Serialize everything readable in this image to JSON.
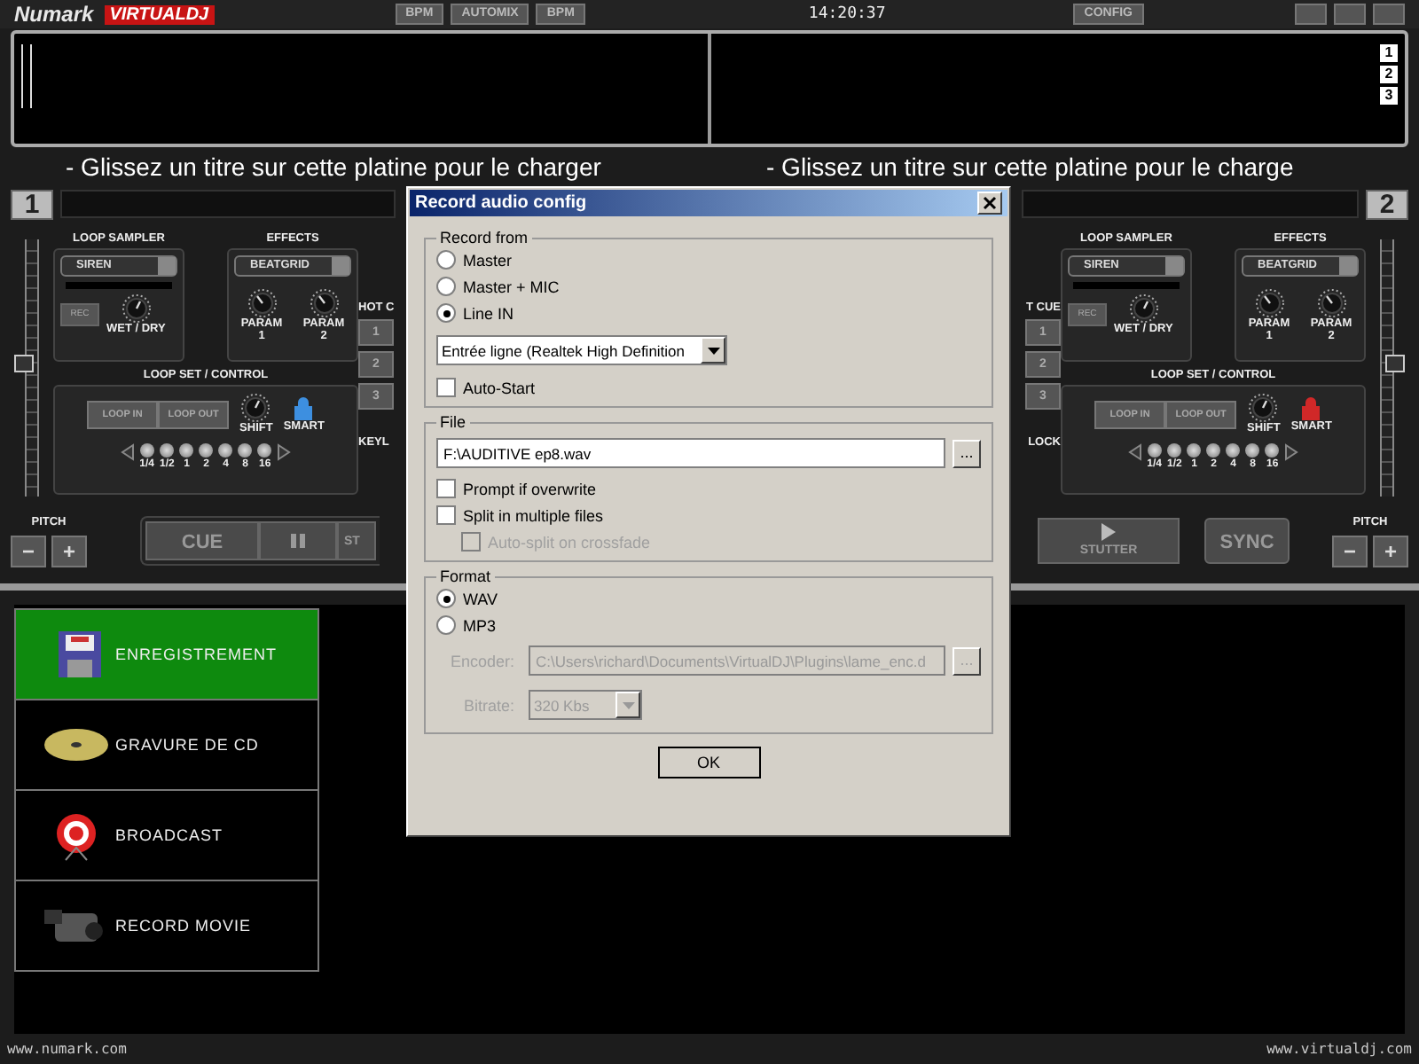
{
  "top_bar": {
    "brand": "Numark",
    "product": "VIRTUALDJ",
    "buttons": [
      "BPM",
      "AUTOMIX",
      "BPM"
    ],
    "clock": "14:20:37",
    "config": "CONFIG"
  },
  "waveform": {
    "deck_numbers": [
      "1",
      "2",
      "3"
    ]
  },
  "drop_hints": [
    "- Glissez un titre sur cette platine pour le charger",
    "- Glissez un titre sur cette platine pour le charge"
  ],
  "decks": [
    {
      "number": "1",
      "pitch_slider": {
        "level": 0.52
      },
      "loop_sampler": {
        "title": "LOOP SAMPLER",
        "sample": "SIREN",
        "rec": "REC",
        "knob": "WET / DRY"
      },
      "effects": {
        "title": "EFFECTS",
        "effect": "BEATGRID",
        "params": [
          "PARAM 1",
          "PARAM 2"
        ]
      },
      "loop_control": {
        "title": "LOOP SET / CONTROL",
        "loop_in": "LOOP IN",
        "loop_out": "LOOP OUT",
        "shift": "SHIFT",
        "smart": {
          "label": "SMART",
          "color": "#3d8fe0"
        },
        "lengths": [
          "1/4",
          "1/2",
          "1",
          "2",
          "4",
          "8",
          "16"
        ]
      },
      "hot_cue": {
        "title": "HOT C",
        "buttons": [
          "1",
          "2",
          "3"
        ],
        "footer": "KEYL"
      },
      "pitch": {
        "label": "PITCH",
        "minus": "−",
        "plus": "+"
      },
      "transport": [
        {
          "kind": "text",
          "label": "CUE"
        },
        {
          "kind": "pause"
        },
        {
          "kind": "text",
          "label": "ST"
        }
      ]
    },
    {
      "number": "2",
      "pitch_slider": {
        "level": 0.52
      },
      "loop_sampler": {
        "title": "LOOP SAMPLER",
        "sample": "SIREN",
        "rec": "REC",
        "knob": "WET / DRY"
      },
      "effects": {
        "title": "EFFECTS",
        "effect": "BEATGRID",
        "params": [
          "PARAM 1",
          "PARAM 2"
        ]
      },
      "loop_control": {
        "title": "LOOP SET / CONTROL",
        "loop_in": "LOOP IN",
        "loop_out": "LOOP OUT",
        "shift": "SHIFT",
        "smart": {
          "label": "SMART",
          "color": "#d02828"
        },
        "lengths": [
          "1/4",
          "1/2",
          "1",
          "2",
          "4",
          "8",
          "16"
        ]
      },
      "hot_cue": {
        "title": "T CUE",
        "buttons": [
          "1",
          "2",
          "3"
        ],
        "footer": "LOCK"
      },
      "pitch": {
        "label": "PITCH",
        "minus": "−",
        "plus": "+"
      },
      "transport": [
        {
          "kind": "stutter",
          "label": "STUTTER"
        },
        {
          "kind": "sync",
          "label": "SYNC"
        }
      ]
    }
  ],
  "sidebar": {
    "items": [
      {
        "kind": "floppy",
        "label": "ENREGISTREMENT",
        "selected": true
      },
      {
        "kind": "cd",
        "label": "GRAVURE DE CD",
        "selected": false
      },
      {
        "kind": "broadcast",
        "label": "BROADCAST",
        "selected": false
      },
      {
        "kind": "camera",
        "label": "RECORD MOVIE",
        "selected": false
      }
    ]
  },
  "footer": {
    "left": "www.numark.com",
    "right": "www.virtualdj.com"
  },
  "dialog": {
    "title": "Record audio config",
    "record_from": {
      "title": "Record from",
      "options": [
        {
          "label": "Master",
          "selected": false
        },
        {
          "label": "Master + MIC",
          "selected": false
        },
        {
          "label": "Line IN",
          "selected": true
        }
      ],
      "source": "Entrée ligne (Realtek High Definition",
      "auto_start": {
        "label": "Auto-Start",
        "checked": false
      }
    },
    "file": {
      "title": "File",
      "path": "F:\\AUDITIVE ep8.wav",
      "browse": "...",
      "options": [
        {
          "label": "Prompt if overwrite",
          "checked": false,
          "disabled": false
        },
        {
          "label": "Split in multiple files",
          "checked": false,
          "disabled": false,
          "children": [
            {
              "label": "Auto-split on crossfade",
              "checked": false,
              "disabled": true
            }
          ]
        }
      ]
    },
    "format": {
      "title": "Format",
      "options": [
        {
          "label": "WAV",
          "selected": true
        },
        {
          "label": "MP3",
          "selected": false
        }
      ],
      "encoder_label": "Encoder:",
      "encoder": "C:\\Users\\richard\\Documents\\VirtualDJ\\Plugins\\lame_enc.d",
      "encoder_browse": "...",
      "bitrate_label": "Bitrate:",
      "bitrate": "320 Kbs",
      "disabled": true
    },
    "ok": "OK"
  }
}
